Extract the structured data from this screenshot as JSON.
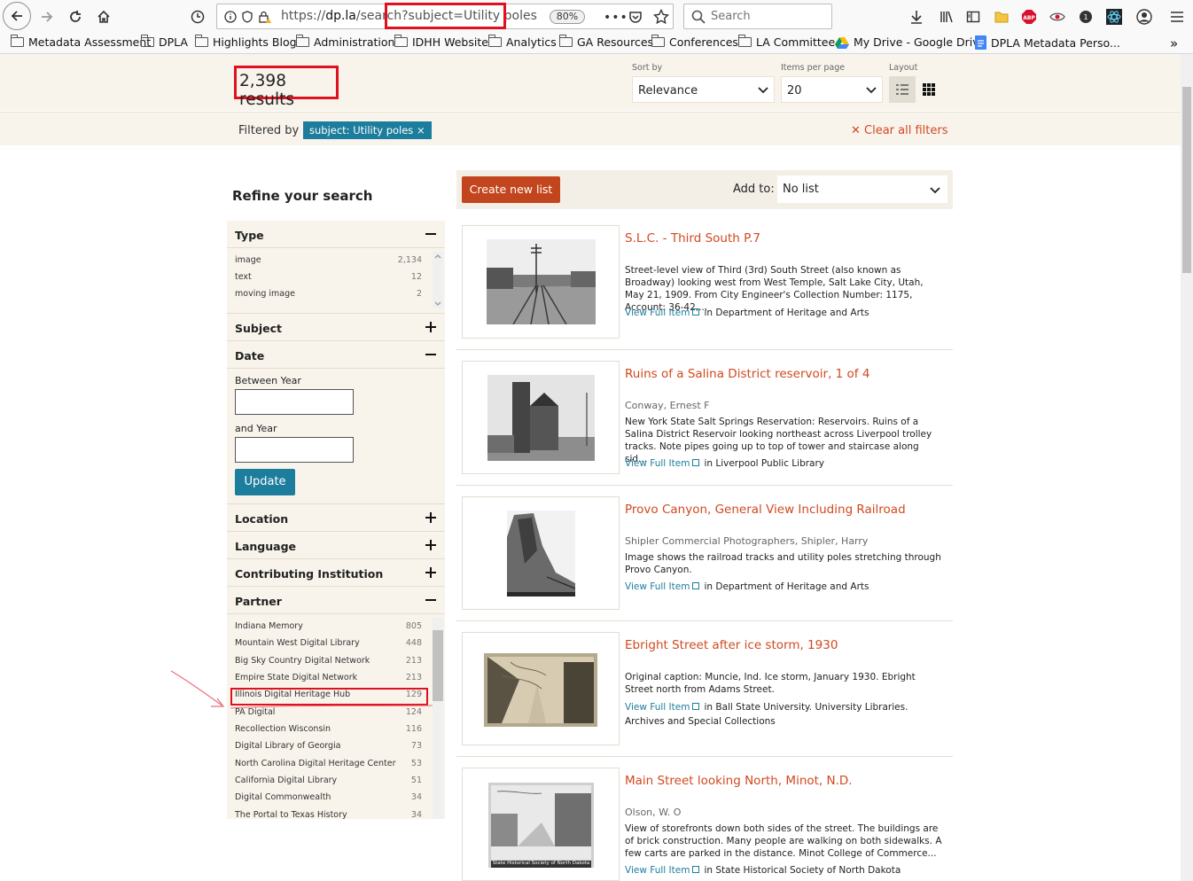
{
  "browser": {
    "url_prefix": "https://",
    "url_host": "dp.la",
    "url_path": "/search",
    "url_query": "?subject=Utility poles",
    "zoom": "80%",
    "search_placeholder": "Search",
    "bookmarks": [
      "Metadata Assessment",
      "DPLA",
      "Highlights Blog",
      "Administration",
      "IDHH Website",
      "Analytics",
      "GA Resources",
      "Conferences",
      "LA Committee",
      "My Drive - Google Drive",
      "DPLA Metadata Perso..."
    ]
  },
  "header": {
    "results_count": "2,398 results",
    "sort_label": "Sort by",
    "sort_value": "Relevance",
    "per_page_label": "Items per page",
    "per_page_value": "20",
    "layout_label": "Layout",
    "filtered_by_label": "Filtered by",
    "filter_tag": "subject: Utility poles ×",
    "clear_all": "✕ Clear all filters"
  },
  "sidebar": {
    "title": "Refine your search",
    "type": {
      "label": "Type",
      "rows": [
        {
          "label": "image",
          "count": "2,134"
        },
        {
          "label": "text",
          "count": "12"
        },
        {
          "label": "moving image",
          "count": "2"
        }
      ]
    },
    "subject_label": "Subject",
    "date": {
      "label": "Date",
      "between_label": "Between Year",
      "and_label": "and Year",
      "update_label": "Update"
    },
    "location_label": "Location",
    "language_label": "Language",
    "institution_label": "Contributing Institution",
    "partner": {
      "label": "Partner",
      "rows": [
        {
          "label": "Indiana Memory",
          "count": "805"
        },
        {
          "label": "Mountain West Digital Library",
          "count": "448"
        },
        {
          "label": "Big Sky Country Digital Network",
          "count": "213"
        },
        {
          "label": "Empire State Digital Network",
          "count": "213"
        },
        {
          "label": "Illinois Digital Heritage Hub",
          "count": "129"
        },
        {
          "label": "PA Digital",
          "count": "124"
        },
        {
          "label": "Recollection Wisconsin",
          "count": "116"
        },
        {
          "label": "Digital Library of Georgia",
          "count": "73"
        },
        {
          "label": "North Carolina Digital Heritage Center",
          "count": "53"
        },
        {
          "label": "California Digital Library",
          "count": "51"
        },
        {
          "label": "Digital Commonwealth",
          "count": "34"
        },
        {
          "label": "The Portal to Texas History",
          "count": "34"
        }
      ]
    }
  },
  "toolbar": {
    "create_list": "Create new list",
    "add_to_label": "Add to:",
    "add_to_value": "No list"
  },
  "results": [
    {
      "title": "S.L.C. - Third South P.7",
      "creator": "",
      "description": "Street-level view of Third (3rd) South Street (also known as Broadway) looking west from West Temple, Salt Lake City, Utah, May 21, 1909. From City Engineer's Collection Number: 1175, Account: 36-42,...",
      "view_label": "View Full Item",
      "institution": "in Department of Heritage and Arts"
    },
    {
      "title": "Ruins of a Salina District reservoir, 1 of 4",
      "creator": "Conway, Ernest F",
      "description": "New York State Salt Springs Reservation: Reservoirs. Ruins of a Salina District Reservoir looking northeast across Liverpool trolley tracks. Note pipes going up to top of tower and staircase along sid...",
      "view_label": "View Full Item",
      "institution": "in Liverpool Public Library"
    },
    {
      "title": "Provo Canyon, General View Including Railroad",
      "creator": "Shipler Commercial Photographers, Shipler, Harry",
      "description": "Image shows the railroad tracks and utility poles stretching through Provo Canyon.",
      "view_label": "View Full Item",
      "institution": "in Department of Heritage and Arts"
    },
    {
      "title": "Ebright Street after ice storm, 1930",
      "creator": "",
      "description": "Original caption: Muncie, Ind. Ice storm, January 1930. Ebright Street north from Adams Street.",
      "view_label": "View Full Item",
      "institution": "in Ball State University. University Libraries. Archives and Special Collections"
    },
    {
      "title": "Main Street looking North, Minot, N.D.",
      "creator": "Olson, W. O",
      "description": "View of storefronts down both sides of the street. The buildings are of brick construction. Many people are walking on both sidewalks. A few carts are parked in the distance. Minot College of Commerce...",
      "view_label": "View Full Item",
      "institution": "in State Historical Society of North Dakota",
      "thumb_caption": "State Historical Society of North Dakota"
    }
  ],
  "colors": {
    "accent_orange": "#d1491f",
    "accent_teal": "#1d7d9d",
    "annotation_red": "#e0101f",
    "panel_beige": "#f8f4ec"
  }
}
